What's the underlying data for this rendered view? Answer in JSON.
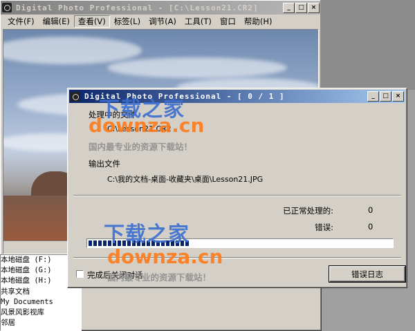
{
  "back_window": {
    "title": "Digital Photo Professional - [C:\\Lesson21.CR2]",
    "menu": [
      "文件(F)",
      "编辑(E)",
      "查看(V)",
      "标签(L)",
      "调节(A)",
      "工具(T)",
      "窗口",
      "帮助(H)"
    ],
    "active_menu_index": 2,
    "window_buttons": {
      "minimize": "_",
      "maximize": "□",
      "close": "×"
    }
  },
  "drive_list": [
    "本地磁盘 (F:)",
    "本地磁盘 (G:)",
    "本地磁盘 (H:)",
    "共享文档",
    "My Documents",
    "风景风影视库",
    "邻居"
  ],
  "dialog": {
    "title": "Digital Photo Professional - [ 0 / 1 ]",
    "processing_label": "处理中的文件",
    "processing_file": "C:\\Lesson21.CR2",
    "output_label": "输出文件",
    "output_file": "C:\\我的文档-桌面-收藏夹\\桌面\\Lesson21.JPG",
    "processed_label": "已正常处理的:",
    "processed_count": "0",
    "errors_label": "错误:",
    "errors_count": "0",
    "progress_fraction": 0.33,
    "close_when_done_label": "完成后关闭对话",
    "close_when_done_checked": false,
    "error_log_button": "错误日志",
    "window_buttons": {
      "minimize": "_",
      "maximize": "□",
      "close": "×"
    }
  },
  "watermarks": {
    "cn": "下载之家",
    "en": "downza.cn",
    "sub": "国内最专业的资源下载站！"
  },
  "colors": {
    "active_title": "#0a246a",
    "progress": "#0a246a",
    "watermark_cn": "#3d6fd0",
    "watermark_en": "#ff7a1a"
  }
}
